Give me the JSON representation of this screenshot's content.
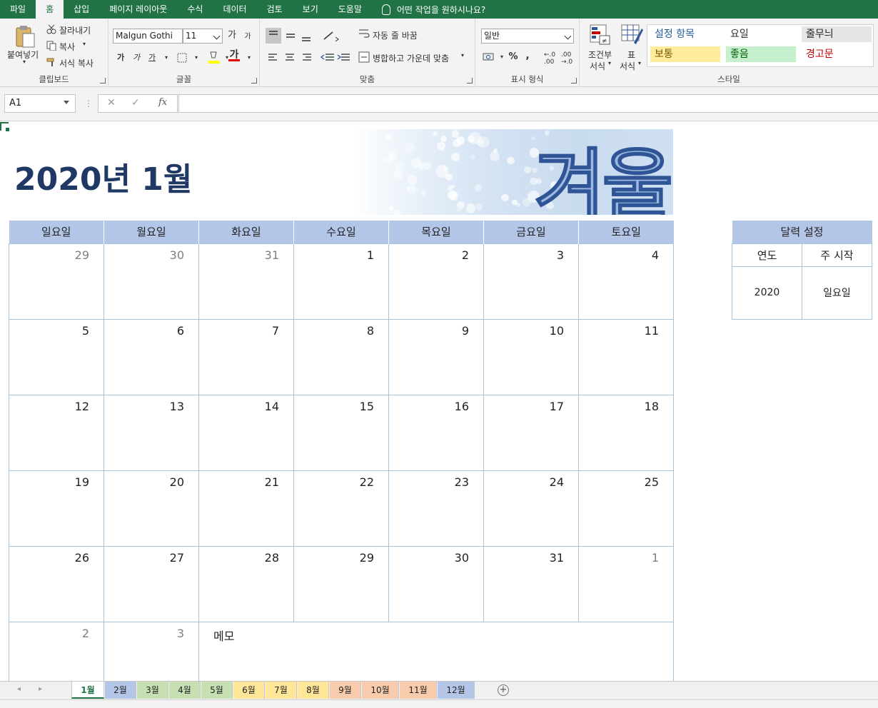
{
  "menu": {
    "tabs": [
      "파일",
      "홈",
      "삽입",
      "페이지 레이아웃",
      "수식",
      "데이터",
      "검토",
      "보기",
      "도움말"
    ],
    "active_tab": "홈",
    "tell_me": "어떤 작업을 원하시나요?"
  },
  "ribbon": {
    "clipboard": {
      "paste": "붙여넣기",
      "cut": "잘라내기",
      "copy": "복사",
      "format_painter": "서식 복사",
      "label": "클립보드"
    },
    "font": {
      "family": "Malgun Gothi",
      "size": "11",
      "grow": "가",
      "shrink": "가",
      "bold": "가",
      "italic": "가",
      "underline": "가",
      "font_color_glyph": "가",
      "label": "글꼴"
    },
    "alignment": {
      "wrap_text": "자동 줄 바꿈",
      "merge_center": "병합하고 가운데 맞춤",
      "label": "맞춤"
    },
    "number": {
      "format": "일반",
      "percent": "%",
      "comma": ",",
      "label": "표시 형식"
    },
    "styles": {
      "conditional": [
        "조건부",
        "서식"
      ],
      "table": [
        "표",
        "서식"
      ],
      "cells": [
        {
          "text": "설정 항목",
          "color": "#1f5c99",
          "bg": "transparent"
        },
        {
          "text": "요일",
          "color": "#333333",
          "bg": "transparent"
        },
        {
          "text": "줄무늬",
          "color": "#222222",
          "bg": "#e7e6e6"
        },
        {
          "text": "보통",
          "color": "#7a5a00",
          "bg": "#ffeb9c"
        },
        {
          "text": "좋음",
          "color": "#006100",
          "bg": "#c6efce"
        },
        {
          "text": "경고문",
          "color": "#c00000",
          "bg": "transparent"
        }
      ],
      "label": "스타일"
    }
  },
  "formula_bar": {
    "name_box": "A1",
    "fx": "fx",
    "value": ""
  },
  "calendar": {
    "title": "2020년 1월",
    "banner_word": "겨울",
    "weekdays": [
      "일요일",
      "월요일",
      "화요일",
      "수요일",
      "목요일",
      "금요일",
      "토요일"
    ],
    "weeks": [
      [
        {
          "d": "29",
          "dim": true
        },
        {
          "d": "30",
          "dim": true
        },
        {
          "d": "31",
          "dim": true
        },
        {
          "d": "1"
        },
        {
          "d": "2"
        },
        {
          "d": "3"
        },
        {
          "d": "4"
        }
      ],
      [
        {
          "d": "5"
        },
        {
          "d": "6"
        },
        {
          "d": "7"
        },
        {
          "d": "8"
        },
        {
          "d": "9"
        },
        {
          "d": "10"
        },
        {
          "d": "11"
        }
      ],
      [
        {
          "d": "12"
        },
        {
          "d": "13"
        },
        {
          "d": "14"
        },
        {
          "d": "15"
        },
        {
          "d": "16"
        },
        {
          "d": "17"
        },
        {
          "d": "18"
        }
      ],
      [
        {
          "d": "19"
        },
        {
          "d": "20"
        },
        {
          "d": "21"
        },
        {
          "d": "22"
        },
        {
          "d": "23"
        },
        {
          "d": "24"
        },
        {
          "d": "25"
        }
      ],
      [
        {
          "d": "26"
        },
        {
          "d": "27"
        },
        {
          "d": "28"
        },
        {
          "d": "29"
        },
        {
          "d": "30"
        },
        {
          "d": "31"
        },
        {
          "d": "1",
          "dim": true
        }
      ]
    ],
    "last_row": [
      {
        "d": "2",
        "dim": true
      },
      {
        "d": "3",
        "dim": true
      }
    ],
    "memo_label": "메모"
  },
  "settings": {
    "title": "달력 설정",
    "col_year": "연도",
    "col_week_start": "주 시작",
    "year": "2020",
    "week_start": "일요일"
  },
  "sheet_tabs": [
    {
      "name": "1월",
      "color": "#ffffff",
      "active": true
    },
    {
      "name": "2월",
      "color": "#b4c6e7"
    },
    {
      "name": "3월",
      "color": "#c6e0b4"
    },
    {
      "name": "4월",
      "color": "#c6e0b4"
    },
    {
      "name": "5월",
      "color": "#c6e0b4"
    },
    {
      "name": "6월",
      "color": "#ffe699"
    },
    {
      "name": "7월",
      "color": "#ffe699"
    },
    {
      "name": "8월",
      "color": "#ffe699"
    },
    {
      "name": "9월",
      "color": "#f8cbad"
    },
    {
      "name": "10월",
      "color": "#f8cbad"
    },
    {
      "name": "11월",
      "color": "#f8cbad"
    },
    {
      "name": "12월",
      "color": "#b4c6e7"
    }
  ],
  "colors": {
    "excel_green": "#217346",
    "header_blue": "#b4c6e7",
    "title_navy": "#1f3864",
    "grid_line": "#a6c3d9"
  }
}
